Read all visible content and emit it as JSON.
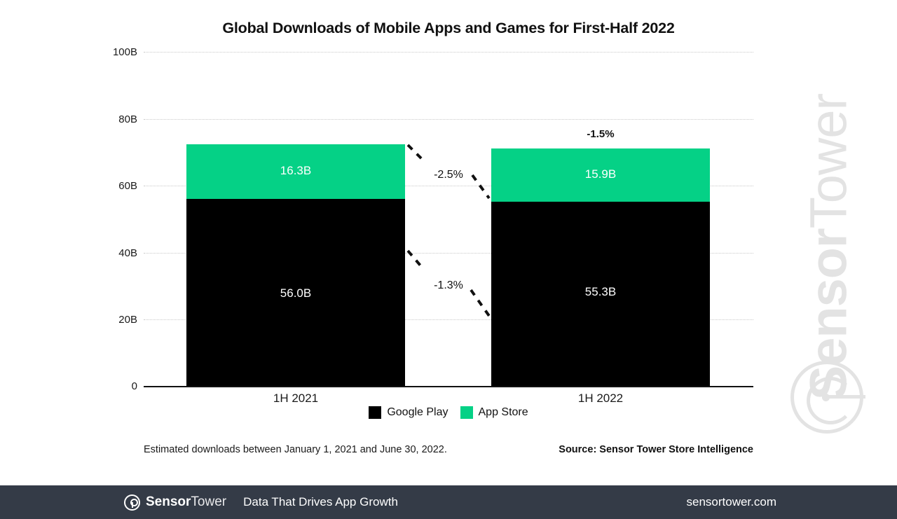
{
  "chart_data": {
    "type": "bar",
    "subtype": "stacked-bar",
    "title": "Global Downloads of Mobile Apps and Games for First-Half 2022",
    "xlabel": "",
    "ylabel": "",
    "ylim": [
      0,
      100
    ],
    "yunit": "B",
    "grid": true,
    "legend_position": "bottom",
    "categories": [
      "1H 2021",
      "1H 2022"
    ],
    "series": [
      {
        "name": "Google Play",
        "color": "#000000",
        "values": [
          56.0,
          55.3
        ],
        "labels": [
          "56.0B",
          "55.3B"
        ]
      },
      {
        "name": "App Store",
        "color": "#05d186",
        "values": [
          16.3,
          15.9
        ],
        "labels": [
          "16.3B",
          "15.9B"
        ]
      }
    ],
    "totals": [
      72.3,
      71.2
    ],
    "yticks": [
      "100B",
      "80B",
      "60B",
      "40B",
      "20B",
      "0"
    ],
    "ytick_values": [
      100,
      80,
      60,
      40,
      20,
      0
    ],
    "annotations": [
      {
        "name": "total-change",
        "text": "-1.5%",
        "series": "Total"
      },
      {
        "name": "app-store-change",
        "text": "-2.5%",
        "series": "App Store"
      },
      {
        "name": "google-play-change",
        "text": "-1.3%",
        "series": "Google Play"
      }
    ]
  },
  "footnote": {
    "left": "Estimated downloads between January 1, 2021 and June 30, 2022.",
    "right": "Source: Sensor Tower Store Intelligence"
  },
  "watermark": {
    "bold": "Sensor",
    "light": "Tower"
  },
  "footer": {
    "logo_bold": "Sensor",
    "logo_light": "Tower",
    "tagline": "Data That Drives App Growth",
    "url": "sensortower.com"
  }
}
